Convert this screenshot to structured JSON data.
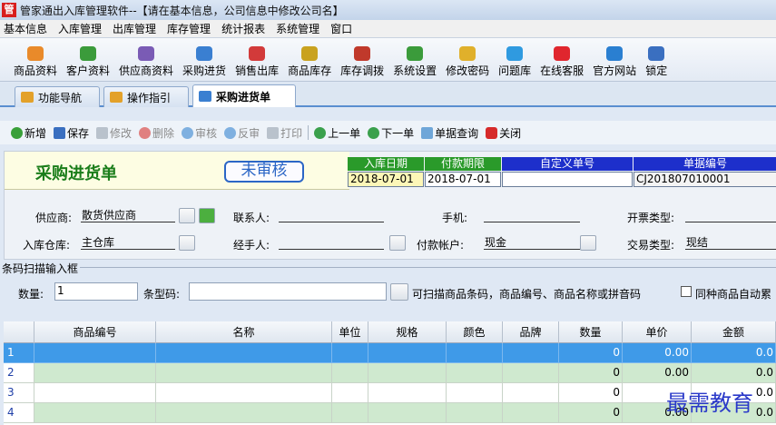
{
  "window": {
    "icon_text": "管",
    "title": "管家通出入库管理软件--【请在基本信息，公司信息中修改公司名】"
  },
  "menu": [
    "基本信息",
    "入库管理",
    "出库管理",
    "库存管理",
    "统计报表",
    "系统管理",
    "窗口"
  ],
  "toolbar": [
    {
      "label": "商品资料",
      "icon": "box-icon",
      "color": "#e98a2a"
    },
    {
      "label": "客户资料",
      "icon": "customer-icon",
      "color": "#3b9b3b"
    },
    {
      "label": "供应商资料",
      "icon": "supplier-icon",
      "color": "#7a5bb5"
    },
    {
      "label": "采购进货",
      "icon": "truck-icon",
      "color": "#3a7fd1"
    },
    {
      "label": "销售出库",
      "icon": "gift-icon",
      "color": "#d23a3a"
    },
    {
      "label": "商品库存",
      "icon": "stock-icon",
      "color": "#c9a21f"
    },
    {
      "label": "库存调拨",
      "icon": "transfer-icon",
      "color": "#c0392b"
    },
    {
      "label": "系统设置",
      "icon": "settings-icon",
      "color": "#3b9b3b"
    },
    {
      "label": "修改密码",
      "icon": "key-icon",
      "color": "#e0b02b"
    },
    {
      "label": "问题库",
      "icon": "help-icon",
      "color": "#2f9ae0"
    },
    {
      "label": "在线客服",
      "icon": "chat-icon",
      "color": "#e0262e"
    },
    {
      "label": "官方网站",
      "icon": "browser-icon",
      "color": "#2a7fd1"
    },
    {
      "label": "锁定",
      "icon": "lock-icon",
      "color": "#3a6fc0"
    }
  ],
  "tabs": [
    {
      "label": "功能导航",
      "icon": "nav-icon",
      "color": "#e3a12a"
    },
    {
      "label": "操作指引",
      "icon": "guide-icon",
      "color": "#e3a12a"
    },
    {
      "label": "采购进货单",
      "icon": "truck-icon",
      "color": "#3a7fd1"
    }
  ],
  "actions": {
    "new": "新增",
    "save": "保存",
    "edit": "修改",
    "delete": "删除",
    "audit": "审核",
    "unaudit": "反审",
    "print": "打印",
    "prev": "上一单",
    "next": "下一单",
    "query": "单据查询",
    "close": "关闭"
  },
  "document": {
    "title": "采购进货单",
    "status": "未审核",
    "headers": {
      "in_date": "入库日期",
      "pay_due": "付款期限",
      "custom_no": "自定义单号",
      "doc_no": "单据编号"
    },
    "values": {
      "in_date": "2018-07-01",
      "pay_due": "2018-07-01",
      "custom_no": "",
      "doc_no": "CJ201807010001"
    },
    "colors": {
      "green_header": "#2a9a2a",
      "blue_header": "#1d2fcb"
    }
  },
  "fields": {
    "supplier_label": "供应商:",
    "supplier_value": "散货供应商",
    "contact_label": "联系人:",
    "contact_value": "",
    "phone_label": "手机:",
    "phone_value": "",
    "invoice_label": "开票类型:",
    "invoice_value": "",
    "warehouse_label": "入库仓库:",
    "warehouse_value": "主仓库",
    "handler_label": "经手人:",
    "handler_value": "",
    "pay_account_label": "付款帐户:",
    "pay_account_value": "现金",
    "trade_type_label": "交易类型:",
    "trade_type_value": "现结"
  },
  "scan": {
    "legend": "条码扫描输入框",
    "qty_label": "数量:",
    "qty_value": "1",
    "barcode_label": "条型码:",
    "barcode_value": "",
    "hint": "可扫描商品条码，商品编号、商品名称或拼音码",
    "auto_merge_label": "同种商品自动累"
  },
  "grid": {
    "columns": [
      "",
      "商品编号",
      "名称",
      "单位",
      "规格",
      "颜色",
      "品牌",
      "数量",
      "单价",
      "金额"
    ],
    "rows": [
      {
        "no": "1",
        "qty": "0",
        "price": "0.00",
        "amount": "0.0"
      },
      {
        "no": "2",
        "qty": "0",
        "price": "0.00",
        "amount": "0.0"
      },
      {
        "no": "3",
        "qty": "0",
        "price": "",
        "amount": "0.0"
      },
      {
        "no": "4",
        "qty": "0",
        "price": "0.00",
        "amount": "0.0"
      }
    ]
  },
  "watermark": "最需教育"
}
